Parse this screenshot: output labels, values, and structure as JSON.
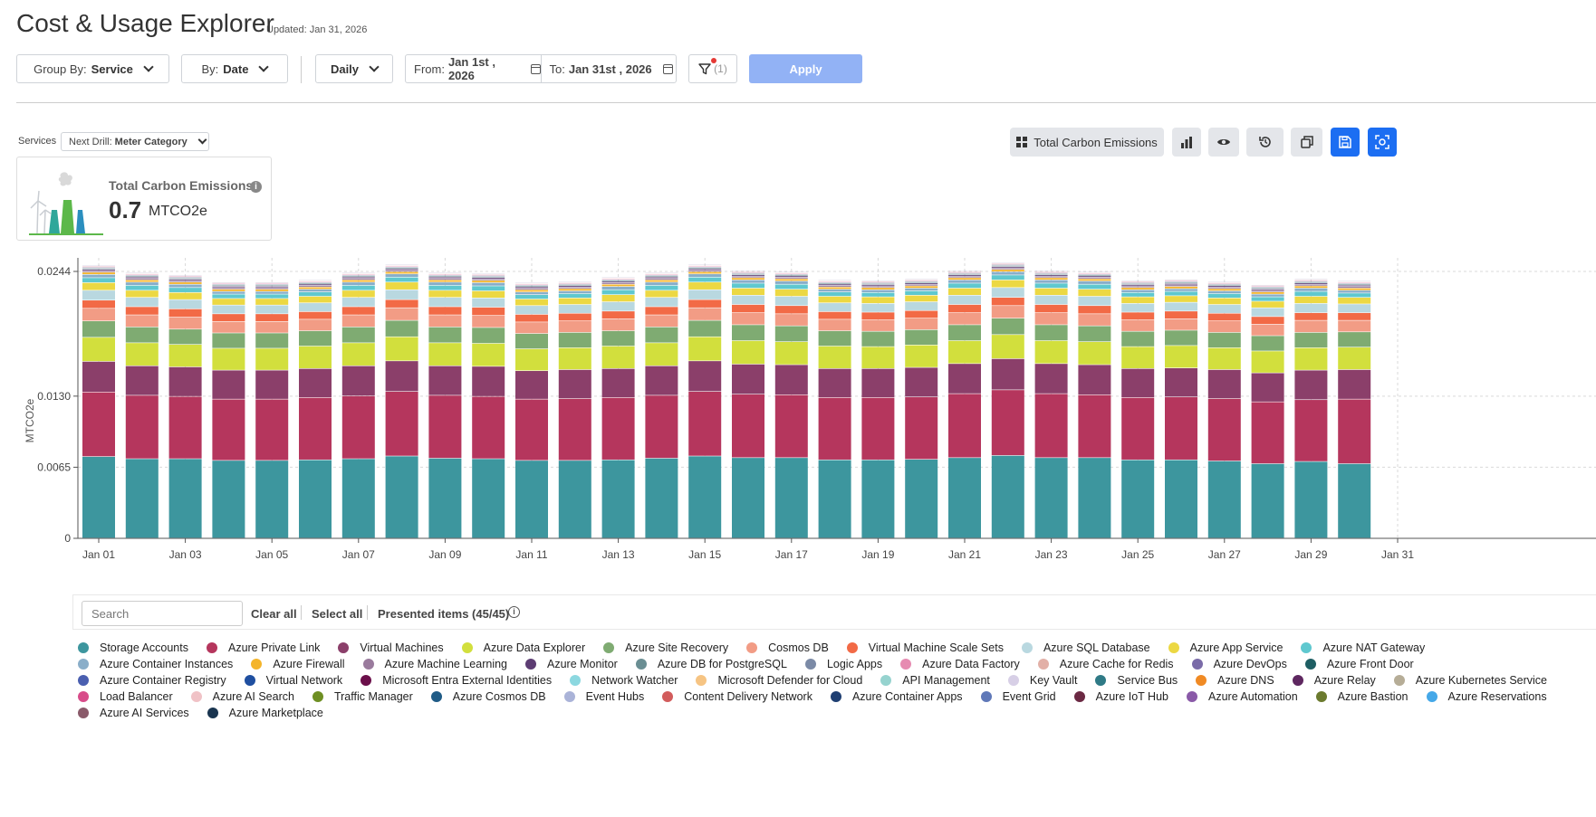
{
  "header": {
    "title": "Cost & Usage Explorer",
    "updated": "Updated: Jan 31, 2026"
  },
  "toolbar": {
    "group_by_prefix": "Group By:",
    "group_by_value": "Service",
    "by_prefix": "By:",
    "by_value": "Date",
    "granularity": "Daily",
    "from_prefix": "From:",
    "from_value": "Jan 1st , 2026",
    "to_prefix": "To:",
    "to_value": "Jan 31st , 2026",
    "filter_count": "(1)",
    "apply_label": "Apply"
  },
  "drill": {
    "services_label": "Services",
    "next_prefix": "Next Drill:",
    "next_value": "Meter Category"
  },
  "kpi": {
    "title": "Total Carbon Emissions",
    "value": "0.7",
    "unit": "MTCO2e"
  },
  "right_toolbar": {
    "metric_label": "Total Carbon Emissions"
  },
  "legend_controls": {
    "search_placeholder": "Search",
    "clear_all": "Clear all",
    "select_all": "Select all",
    "presented": "Presented items (45/45)"
  },
  "colors": {
    "accent": "#1c6ef2",
    "apply_disabled": "#92b2f5"
  },
  "chart_data": {
    "type": "bar",
    "stacked": true,
    "ylabel": "MTCO2e",
    "ylim": [
      0,
      0.0244
    ],
    "yticks": [
      "0",
      "0.0065",
      "0.0130",
      "0.0244"
    ],
    "xticks": [
      "Jan 01",
      "Jan 03",
      "Jan 05",
      "Jan 07",
      "Jan 09",
      "Jan 11",
      "Jan 13",
      "Jan 15",
      "Jan 17",
      "Jan 19",
      "Jan 21",
      "Jan 23",
      "Jan 25",
      "Jan 27",
      "Jan 29",
      "Jan 31"
    ],
    "grid": true,
    "categories": [
      "Jan 01",
      "Jan 02",
      "Jan 03",
      "Jan 04",
      "Jan 05",
      "Jan 06",
      "Jan 07",
      "Jan 08",
      "Jan 09",
      "Jan 10",
      "Jan 11",
      "Jan 12",
      "Jan 13",
      "Jan 14",
      "Jan 15",
      "Jan 16",
      "Jan 17",
      "Jan 18",
      "Jan 19",
      "Jan 20",
      "Jan 21",
      "Jan 22",
      "Jan 23",
      "Jan 24",
      "Jan 25",
      "Jan 26",
      "Jan 27",
      "Jan 28",
      "Jan 29",
      "Jan 30"
    ],
    "series": [
      {
        "name": "Storage Accounts",
        "color": "#3d969e",
        "values": [
          0.00745,
          0.00725,
          0.00725,
          0.0071,
          0.0071,
          0.00715,
          0.00725,
          0.0075,
          0.0073,
          0.00725,
          0.0071,
          0.0071,
          0.00715,
          0.0073,
          0.0075,
          0.00735,
          0.00735,
          0.00715,
          0.00715,
          0.0072,
          0.00735,
          0.00755,
          0.00735,
          0.00735,
          0.00715,
          0.00715,
          0.00705,
          0.0068,
          0.007,
          0.0068
        ]
      },
      {
        "name": "Azure Private Link",
        "color": "#b5365d",
        "values": [
          0.0059,
          0.0058,
          0.0057,
          0.0056,
          0.0056,
          0.0057,
          0.00575,
          0.0059,
          0.00575,
          0.0057,
          0.0056,
          0.00565,
          0.0057,
          0.00575,
          0.0059,
          0.0058,
          0.00575,
          0.0057,
          0.0057,
          0.0057,
          0.00585,
          0.006,
          0.00585,
          0.00575,
          0.0057,
          0.00575,
          0.0057,
          0.00565,
          0.00565,
          0.0059
        ]
      },
      {
        "name": "Virtual Machines",
        "color": "#8b3f6a",
        "values": [
          0.0028,
          0.0027,
          0.0027,
          0.00265,
          0.00265,
          0.00265,
          0.00275,
          0.0028,
          0.0027,
          0.00275,
          0.0026,
          0.00265,
          0.00265,
          0.0027,
          0.0028,
          0.00275,
          0.00275,
          0.00265,
          0.00265,
          0.0027,
          0.00275,
          0.00285,
          0.00275,
          0.00275,
          0.00265,
          0.00265,
          0.00265,
          0.00265,
          0.0027,
          0.0027
        ]
      },
      {
        "name": "Azure Data Explorer",
        "color": "#d2df3d",
        "values": [
          0.0022,
          0.0021,
          0.00205,
          0.002,
          0.002,
          0.00205,
          0.0021,
          0.0022,
          0.0021,
          0.0021,
          0.002,
          0.002,
          0.00205,
          0.0021,
          0.0022,
          0.00215,
          0.0021,
          0.00205,
          0.002,
          0.00205,
          0.0021,
          0.0022,
          0.0021,
          0.0021,
          0.002,
          0.00205,
          0.002,
          0.002,
          0.00205,
          0.00205
        ]
      },
      {
        "name": "Azure Site Recovery",
        "color": "#7fab72",
        "values": [
          0.0015,
          0.00145,
          0.0014,
          0.0014,
          0.0014,
          0.0014,
          0.00145,
          0.0015,
          0.00145,
          0.00145,
          0.0014,
          0.0014,
          0.0014,
          0.00145,
          0.0015,
          0.00145,
          0.00145,
          0.0014,
          0.0014,
          0.0014,
          0.00145,
          0.0015,
          0.00145,
          0.00145,
          0.0014,
          0.0014,
          0.0014,
          0.0014,
          0.0014,
          0.0014
        ]
      },
      {
        "name": "Cosmos DB",
        "color": "#f29c85",
        "values": [
          0.00115,
          0.0011,
          0.0011,
          0.00105,
          0.00105,
          0.00105,
          0.0011,
          0.00115,
          0.0011,
          0.0011,
          0.00105,
          0.00105,
          0.0011,
          0.0011,
          0.00115,
          0.0011,
          0.0011,
          0.00105,
          0.00105,
          0.00105,
          0.0011,
          0.00115,
          0.0011,
          0.0011,
          0.00105,
          0.00105,
          0.00105,
          0.00105,
          0.0011,
          0.00105
        ]
      },
      {
        "name": "Virtual Machine Scale Sets",
        "color": "#f26a46",
        "values": [
          0.00075,
          0.00075,
          0.00075,
          0.0007,
          0.0007,
          0.0007,
          0.00075,
          0.00075,
          0.00075,
          0.00075,
          0.0007,
          0.0007,
          0.0007,
          0.00075,
          0.00075,
          0.00075,
          0.00075,
          0.0007,
          0.0007,
          0.0007,
          0.00075,
          0.00075,
          0.00075,
          0.00075,
          0.0007,
          0.0007,
          0.0007,
          0.0007,
          0.0007,
          0.0007
        ]
      },
      {
        "name": "Azure SQL Database",
        "color": "#b9d8e0",
        "values": [
          0.0009,
          0.00085,
          0.00085,
          0.0008,
          0.0008,
          0.0008,
          0.00085,
          0.0009,
          0.00085,
          0.00085,
          0.0008,
          0.0008,
          0.00085,
          0.00085,
          0.0009,
          0.00085,
          0.00085,
          0.0008,
          0.0008,
          0.0008,
          0.00085,
          0.0009,
          0.00085,
          0.00085,
          0.0008,
          0.0008,
          0.0008,
          0.0008,
          0.00085,
          0.0008
        ]
      },
      {
        "name": "Azure App Service",
        "color": "#ecd843",
        "values": [
          0.0007,
          0.00065,
          0.00065,
          0.0006,
          0.0006,
          0.0006,
          0.00065,
          0.0007,
          0.00065,
          0.00065,
          0.0006,
          0.0006,
          0.00065,
          0.00065,
          0.0007,
          0.00065,
          0.00065,
          0.0006,
          0.0006,
          0.0006,
          0.00065,
          0.0007,
          0.00065,
          0.00065,
          0.0006,
          0.0006,
          0.0006,
          0.0006,
          0.00065,
          0.0006
        ]
      },
      {
        "name": "Azure NAT Gateway",
        "color": "#5fc8cf",
        "values": [
          0.00045,
          0.00045,
          0.00045,
          0.0004,
          0.0004,
          0.0004,
          0.00045,
          0.00045,
          0.00045,
          0.00045,
          0.0004,
          0.0004,
          0.00045,
          0.00045,
          0.00045,
          0.00045,
          0.00045,
          0.0004,
          0.0004,
          0.0004,
          0.00045,
          0.00045,
          0.00045,
          0.00045,
          0.0004,
          0.0004,
          0.0004,
          0.0004,
          0.00045,
          0.0004
        ]
      },
      {
        "name": "Azure Container Instances",
        "color": "#8aaec9",
        "values": [
          0.0003,
          0.0003,
          0.0003,
          0.00025,
          0.00025,
          0.00025,
          0.0003,
          0.0003,
          0.0003,
          0.0003,
          0.00025,
          0.00025,
          0.0003,
          0.0003,
          0.0003,
          0.0003,
          0.0003,
          0.00025,
          0.00025,
          0.00025,
          0.0003,
          0.0003,
          0.0003,
          0.0003,
          0.00025,
          0.00025,
          0.00025,
          0.00025,
          0.0003,
          0.00025
        ]
      },
      {
        "name": "Azure Firewall",
        "color": "#f4b42a",
        "values": [
          0.0002,
          0.0002,
          0.0002,
          0.0002,
          0.0002,
          0.0002,
          0.0002,
          0.0002,
          0.0002,
          0.0002,
          0.0002,
          0.0002,
          0.0002,
          0.0002,
          0.0002,
          0.0002,
          0.0002,
          0.0002,
          0.0002,
          0.0002,
          0.0002,
          0.0002,
          0.0002,
          0.0002,
          0.0002,
          0.0002,
          0.0002,
          0.0002,
          0.0002,
          0.0002
        ]
      },
      {
        "name": "Azure Machine Learning",
        "color": "#9a7b9d",
        "values": [
          0.00015,
          0.00015,
          0.00015,
          0.00015,
          0.00015,
          0.00015,
          0.00015,
          0.00015,
          0.00015,
          0.00015,
          0.00015,
          0.00015,
          0.00015,
          0.00015,
          0.00015,
          0.00015,
          0.00015,
          0.00015,
          0.00015,
          0.00015,
          0.00015,
          0.00015,
          0.00015,
          0.00015,
          0.00015,
          0.00015,
          0.00015,
          0.00015,
          0.00015,
          0.00015
        ]
      },
      {
        "name": "Azure Monitor",
        "color": "#5d3d73",
        "values": [
          0.00012,
          0.00012,
          0.00012,
          0.00012,
          0.00012,
          0.00012,
          0.00012,
          0.00012,
          0.00012,
          0.00012,
          0.00012,
          0.00012,
          0.00012,
          0.00012,
          0.00012,
          0.00012,
          0.00012,
          0.00012,
          0.00012,
          0.00012,
          0.00012,
          0.00012,
          0.00012,
          0.00012,
          0.00012,
          0.00012,
          0.00012,
          0.00012,
          0.00012,
          0.00012
        ]
      },
      {
        "name": "Azure DB for PostgreSQL",
        "color": "#6a8e93",
        "values": [
          0.0001,
          0.0001,
          0.0001,
          0.0001,
          0.0001,
          0.0001,
          0.0001,
          0.0001,
          0.0001,
          0.0001,
          0.0001,
          0.0001,
          0.0001,
          0.0001,
          0.0001,
          0.0001,
          0.0001,
          0.0001,
          0.0001,
          0.0001,
          0.0001,
          0.0001,
          0.0001,
          0.0001,
          0.0001,
          0.0001,
          0.0001,
          0.0001,
          0.0001,
          0.0001
        ]
      },
      {
        "name": "Logic Apps",
        "color": "#7b8aa6",
        "values": [
          8e-05,
          8e-05,
          8e-05,
          8e-05,
          8e-05,
          8e-05,
          8e-05,
          8e-05,
          8e-05,
          8e-05,
          8e-05,
          8e-05,
          8e-05,
          8e-05,
          8e-05,
          8e-05,
          8e-05,
          8e-05,
          8e-05,
          8e-05,
          8e-05,
          8e-05,
          8e-05,
          8e-05,
          8e-05,
          8e-05,
          8e-05,
          8e-05,
          8e-05,
          8e-05
        ]
      },
      {
        "name": "Azure Data Factory",
        "color": "#e68bb1",
        "values": [
          8e-05,
          8e-05,
          8e-05,
          8e-05,
          8e-05,
          8e-05,
          8e-05,
          8e-05,
          8e-05,
          8e-05,
          8e-05,
          8e-05,
          8e-05,
          8e-05,
          8e-05,
          8e-05,
          8e-05,
          8e-05,
          8e-05,
          8e-05,
          8e-05,
          8e-05,
          8e-05,
          8e-05,
          8e-05,
          8e-05,
          8e-05,
          8e-05,
          8e-05,
          8e-05
        ]
      },
      {
        "name": "Azure Cache for Redis",
        "color": "#e2b0a7",
        "values": [
          6e-05,
          6e-05,
          6e-05,
          6e-05,
          6e-05,
          6e-05,
          6e-05,
          6e-05,
          6e-05,
          6e-05,
          6e-05,
          6e-05,
          6e-05,
          6e-05,
          6e-05,
          6e-05,
          6e-05,
          6e-05,
          6e-05,
          6e-05,
          6e-05,
          6e-05,
          6e-05,
          6e-05,
          6e-05,
          6e-05,
          6e-05,
          6e-05,
          6e-05,
          6e-05
        ]
      },
      {
        "name": "Azure DevOps",
        "color": "#7a6ba8",
        "values": [
          6e-05,
          6e-05,
          6e-05,
          6e-05,
          6e-05,
          6e-05,
          6e-05,
          6e-05,
          6e-05,
          6e-05,
          6e-05,
          6e-05,
          6e-05,
          6e-05,
          6e-05,
          6e-05,
          6e-05,
          6e-05,
          6e-05,
          6e-05,
          6e-05,
          6e-05,
          6e-05,
          6e-05,
          6e-05,
          6e-05,
          6e-05,
          6e-05,
          6e-05,
          6e-05
        ]
      },
      {
        "name": "Azure Front Door",
        "color": "#1e5e63",
        "values": [
          5e-05,
          5e-05,
          5e-05,
          5e-05,
          5e-05,
          5e-05,
          5e-05,
          5e-05,
          5e-05,
          5e-05,
          5e-05,
          5e-05,
          5e-05,
          5e-05,
          5e-05,
          5e-05,
          5e-05,
          5e-05,
          5e-05,
          5e-05,
          5e-05,
          5e-05,
          5e-05,
          5e-05,
          5e-05,
          5e-05,
          5e-05,
          5e-05,
          5e-05,
          5e-05
        ]
      }
    ]
  },
  "legend_items": [
    {
      "name": "Storage Accounts",
      "color": "#3d969e"
    },
    {
      "name": "Azure Private Link",
      "color": "#b5365d"
    },
    {
      "name": "Virtual Machines",
      "color": "#8b3f6a"
    },
    {
      "name": "Azure Data Explorer",
      "color": "#d2df3d"
    },
    {
      "name": "Azure Site Recovery",
      "color": "#7fab72"
    },
    {
      "name": "Cosmos DB",
      "color": "#f29c85"
    },
    {
      "name": "Virtual Machine Scale Sets",
      "color": "#f26a46"
    },
    {
      "name": "Azure SQL Database",
      "color": "#b9d8e0"
    },
    {
      "name": "Azure App Service",
      "color": "#ecd843"
    },
    {
      "name": "Azure NAT Gateway",
      "color": "#5fc8cf"
    },
    {
      "name": "Azure Container Instances",
      "color": "#8aaec9"
    },
    {
      "name": "Azure Firewall",
      "color": "#f4b42a"
    },
    {
      "name": "Azure Machine Learning",
      "color": "#9a7b9d"
    },
    {
      "name": "Azure Monitor",
      "color": "#5d3d73"
    },
    {
      "name": "Azure DB for PostgreSQL",
      "color": "#6a8e93"
    },
    {
      "name": "Logic Apps",
      "color": "#7b8aa6"
    },
    {
      "name": "Azure Data Factory",
      "color": "#e68bb1"
    },
    {
      "name": "Azure Cache for Redis",
      "color": "#e2b0a7"
    },
    {
      "name": "Azure DevOps",
      "color": "#7a6ba8"
    },
    {
      "name": "Azure Front Door",
      "color": "#1e5e63"
    },
    {
      "name": "Azure Container Registry",
      "color": "#4a5fb0"
    },
    {
      "name": "Virtual Network",
      "color": "#1f4fa0"
    },
    {
      "name": "Microsoft Entra External Identities",
      "color": "#6b0f4a"
    },
    {
      "name": "Network Watcher",
      "color": "#8cd8e0"
    },
    {
      "name": "Microsoft Defender for Cloud",
      "color": "#f6c483"
    },
    {
      "name": "API Management",
      "color": "#96d3cf"
    },
    {
      "name": "Key Vault",
      "color": "#d7cfe6"
    },
    {
      "name": "Service Bus",
      "color": "#2f7a86"
    },
    {
      "name": "Azure DNS",
      "color": "#f08a24"
    },
    {
      "name": "Azure Relay",
      "color": "#5e2760"
    },
    {
      "name": "Azure Kubernetes Service",
      "color": "#b6ad97"
    },
    {
      "name": "Load Balancer",
      "color": "#d84c8a"
    },
    {
      "name": "Azure AI Search",
      "color": "#f0c2c6"
    },
    {
      "name": "Traffic Manager",
      "color": "#6e8f23"
    },
    {
      "name": "Azure Cosmos DB",
      "color": "#1f5b86"
    },
    {
      "name": "Event Hubs",
      "color": "#aab3d8"
    },
    {
      "name": "Content Delivery Network",
      "color": "#d25c5c"
    },
    {
      "name": "Azure Container Apps",
      "color": "#1f3f72"
    },
    {
      "name": "Event Grid",
      "color": "#5f78b8"
    },
    {
      "name": "Azure IoT Hub",
      "color": "#6b2943"
    },
    {
      "name": "Azure Automation",
      "color": "#8a5aa8"
    },
    {
      "name": "Azure Bastion",
      "color": "#6b7a2e"
    },
    {
      "name": "Azure Reservations",
      "color": "#45a8e8"
    },
    {
      "name": "Azure AI Services",
      "color": "#8a5a6a"
    },
    {
      "name": "Azure Marketplace",
      "color": "#1a3550"
    }
  ]
}
